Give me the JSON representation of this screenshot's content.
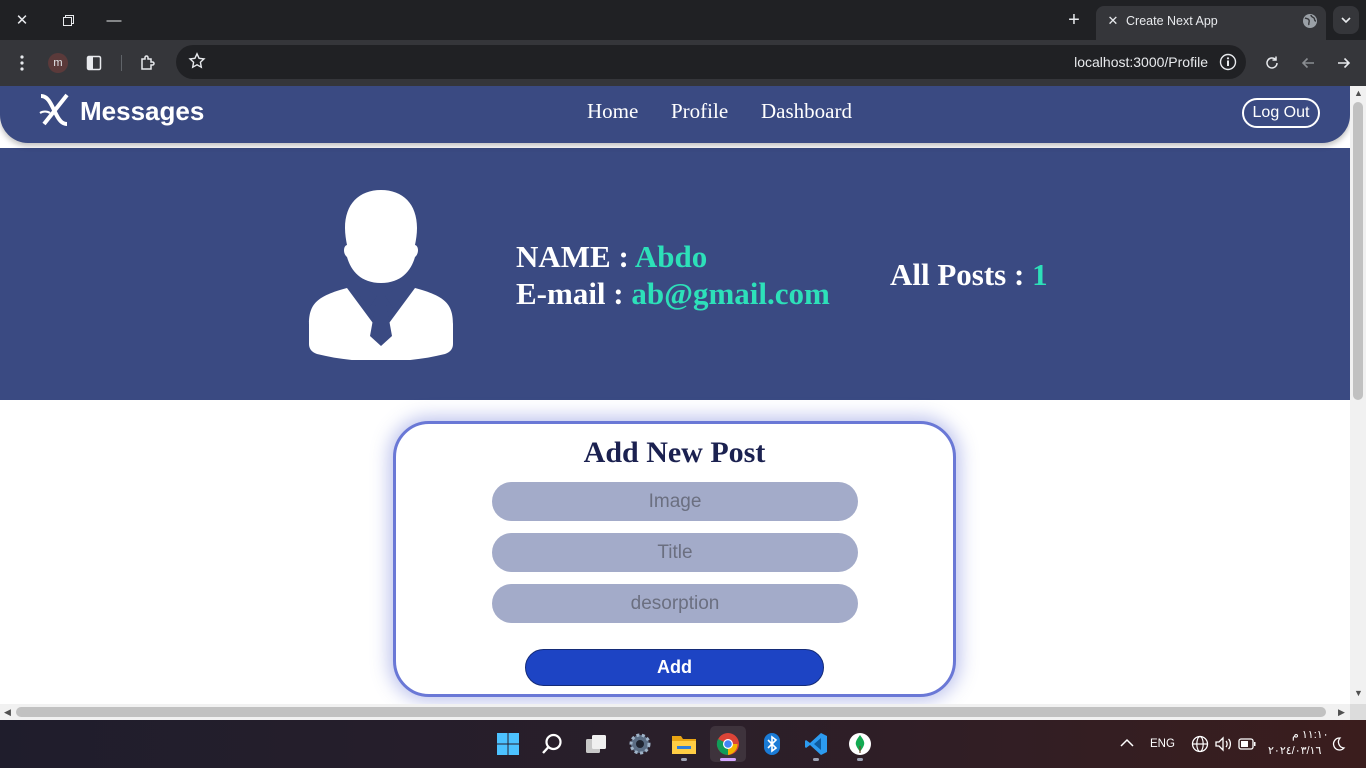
{
  "browser": {
    "tab_title": "Create Next App",
    "url": "localhost:3000/Profile",
    "profile_initial": "m"
  },
  "navbar": {
    "brand": "Messages",
    "links": [
      "Home",
      "Profile",
      "Dashboard"
    ],
    "logout_label": "Log Out"
  },
  "profile": {
    "name_label": "NAME : ",
    "name_value": "Abdo",
    "email_label": "E-mail : ",
    "email_value": "ab@gmail.com",
    "posts_label": "All Posts : ",
    "posts_value": "1"
  },
  "new_post": {
    "title": "Add New Post",
    "image_placeholder": "Image",
    "title_placeholder": "Title",
    "description_placeholder": "desorption",
    "submit_label": "Add"
  },
  "taskbar": {
    "language": "ENG",
    "time": "١١:١٠ م",
    "date": "٢٠٢٤/٠٣/١٦"
  },
  "colors": {
    "navbar_bg": "#3a4a82",
    "accent": "#2de0b9",
    "button": "#1d44c4"
  }
}
